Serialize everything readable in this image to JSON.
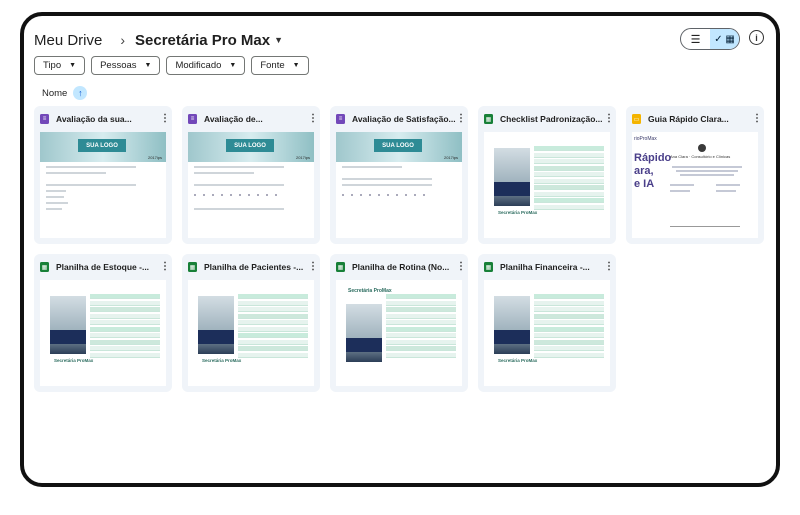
{
  "header": {
    "root": "Meu Drive",
    "current_folder": "Secretária Pro Max"
  },
  "view_toggle": {
    "list_icon": "☰",
    "grid_icon": "✓ ▦",
    "info_icon": "i"
  },
  "filters": [
    {
      "label": "Tipo"
    },
    {
      "label": "Pessoas"
    },
    {
      "label": "Modificado"
    },
    {
      "label": "Fonte"
    }
  ],
  "sort": {
    "label": "Nome",
    "direction_icon": "↑"
  },
  "files": [
    {
      "type": "forms",
      "title": "Avaliação da sua...",
      "thumb_logo": "SUA LOGO",
      "thumb_year": "2017ips"
    },
    {
      "type": "forms",
      "title": "Avaliação de...",
      "thumb_logo": "SUA LOGO",
      "thumb_year": "2017ips"
    },
    {
      "type": "forms",
      "title": "Avaliação de Satisfação...",
      "thumb_logo": "SUA LOGO",
      "thumb_year": "2017ips"
    },
    {
      "type": "sheets",
      "title": "Checklist Padronização...",
      "thumb_brand": "Secretária ProMax"
    },
    {
      "type": "slides",
      "title": "Guia Rápido Clara...",
      "thumb_top": "rioProMax",
      "thumb_big": "Rápido\nara,\ne IA",
      "thumb_name": "Ana Clara · Consultório e Clínicas"
    },
    {
      "type": "sheets",
      "title": "Planilha de Estoque -...",
      "thumb_brand": "Secretária ProMax"
    },
    {
      "type": "sheets",
      "title": "Planilha de Pacientes -...",
      "thumb_brand": "Secretária ProMax"
    },
    {
      "type": "sheets",
      "title": "Planilha de Rotina (No...",
      "thumb_brand": "Secretária ProMax"
    },
    {
      "type": "sheets",
      "title": "Planilha Financeira -...",
      "thumb_brand": "Secretária ProMax"
    }
  ],
  "colors": {
    "forms": "#7248b9",
    "sheets": "#188038",
    "slides": "#f4b400",
    "selected_toggle": "#c2e7ff"
  }
}
